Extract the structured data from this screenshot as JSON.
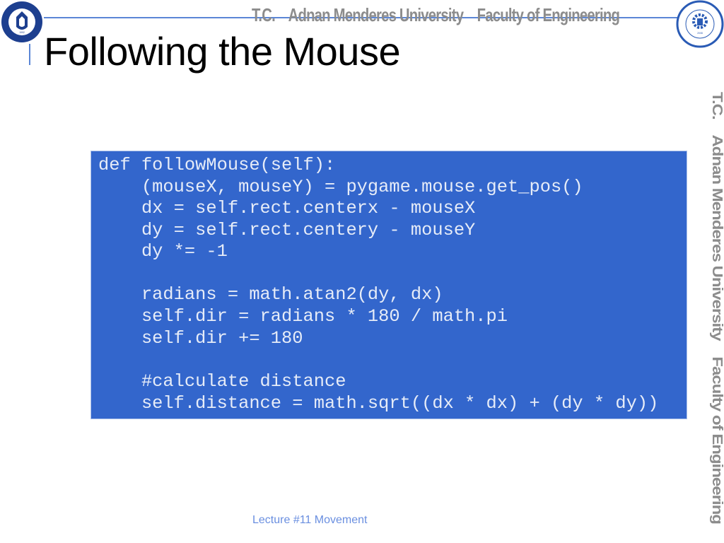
{
  "slide": {
    "title": "Following the Mouse",
    "banner": {
      "text": "T.C.    Adnan Menderes University    Faculty of Engineering",
      "vertical_text": "T.C.    Adnan Menderes University    Faculty of Engineering"
    },
    "logos": {
      "left": {
        "icon": "university-seal-icon",
        "ring_text": "ADNAN MENDERES ÜNİVERSİTESİ",
        "year": "1992"
      },
      "right": {
        "icon": "engineering-faculty-seal-icon",
        "ring_text": "ADNAN MENDERES UNIVERSITY ENGINEERING FACULTY",
        "year": "2008"
      }
    },
    "code": {
      "language": "python",
      "lines": [
        "def followMouse(self):",
        "    (mouseX, mouseY) = pygame.mouse.get_pos()",
        "    dx = self.rect.centerx - mouseX",
        "    dy = self.rect.centery - mouseY",
        "    dy *= -1",
        "",
        "    radians = math.atan2(dy, dx)",
        "    self.dir = radians * 180 / math.pi",
        "    self.dir += 180",
        "",
        "    #calculate distance",
        "    self.distance = math.sqrt((dx * dx) + (dy * dy))"
      ]
    },
    "footer": "Lecture #11 Movement",
    "colors": {
      "accent": "#5b86d6",
      "code_background": "#3366cc",
      "code_text": "#e6ecf8",
      "banner_text": "#8c8c8c",
      "footer_text": "#6a8fe0"
    }
  }
}
